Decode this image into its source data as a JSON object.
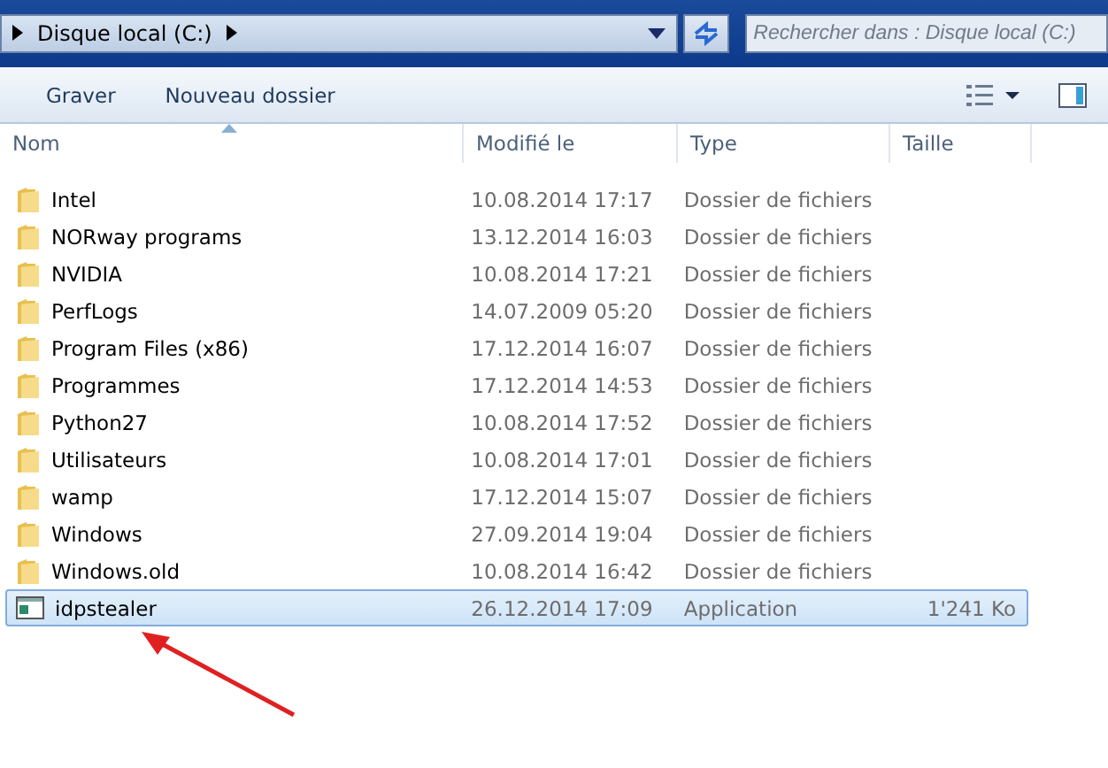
{
  "address_bar": {
    "path": "Disque local (C:)"
  },
  "search": {
    "placeholder": "Rechercher dans : Disque local (C:)"
  },
  "toolbar": {
    "buttons": [
      "Graver",
      "Nouveau dossier"
    ]
  },
  "columns": [
    {
      "label": "Nom",
      "sorted": true
    },
    {
      "label": "Modifié le",
      "sorted": false
    },
    {
      "label": "Type",
      "sorted": false
    },
    {
      "label": "Taille",
      "sorted": false
    }
  ],
  "rows": [
    {
      "kind": "folder",
      "name": "Intel",
      "modified": "10.08.2014 17:17",
      "type": "Dossier de fichiers",
      "selected": false
    },
    {
      "kind": "folder",
      "name": "NORway programs",
      "modified": "13.12.2014 16:03",
      "type": "Dossier de fichiers",
      "selected": false
    },
    {
      "kind": "folder",
      "name": "NVIDIA",
      "modified": "10.08.2014 17:21",
      "type": "Dossier de fichiers",
      "selected": false
    },
    {
      "kind": "folder",
      "name": "PerfLogs",
      "modified": "14.07.2009 05:20",
      "type": "Dossier de fichiers",
      "selected": false
    },
    {
      "kind": "folder",
      "name": "Program Files (x86)",
      "modified": "17.12.2014 16:07",
      "type": "Dossier de fichiers",
      "selected": false
    },
    {
      "kind": "folder",
      "name": "Programmes",
      "modified": "17.12.2014 14:53",
      "type": "Dossier de fichiers",
      "selected": false
    },
    {
      "kind": "folder",
      "name": "Python27",
      "modified": "10.08.2014 17:52",
      "type": "Dossier de fichiers",
      "selected": false
    },
    {
      "kind": "folder",
      "name": "Utilisateurs",
      "modified": "10.08.2014 17:01",
      "type": "Dossier de fichiers",
      "selected": false
    },
    {
      "kind": "folder",
      "name": "wamp",
      "modified": "17.12.2014 15:07",
      "type": "Dossier de fichiers",
      "selected": false
    },
    {
      "kind": "folder",
      "name": "Windows",
      "modified": "27.09.2014 19:04",
      "type": "Dossier de fichiers",
      "selected": false
    },
    {
      "kind": "folder",
      "name": "Windows.old",
      "modified": "10.08.2014 16:42",
      "type": "Dossier de fichiers",
      "selected": false
    },
    {
      "kind": "application",
      "name": "idpstealer",
      "modified": "26.12.2014 17:09",
      "type": "Application",
      "size": "1'241 Ko",
      "selected": true
    }
  ]
}
